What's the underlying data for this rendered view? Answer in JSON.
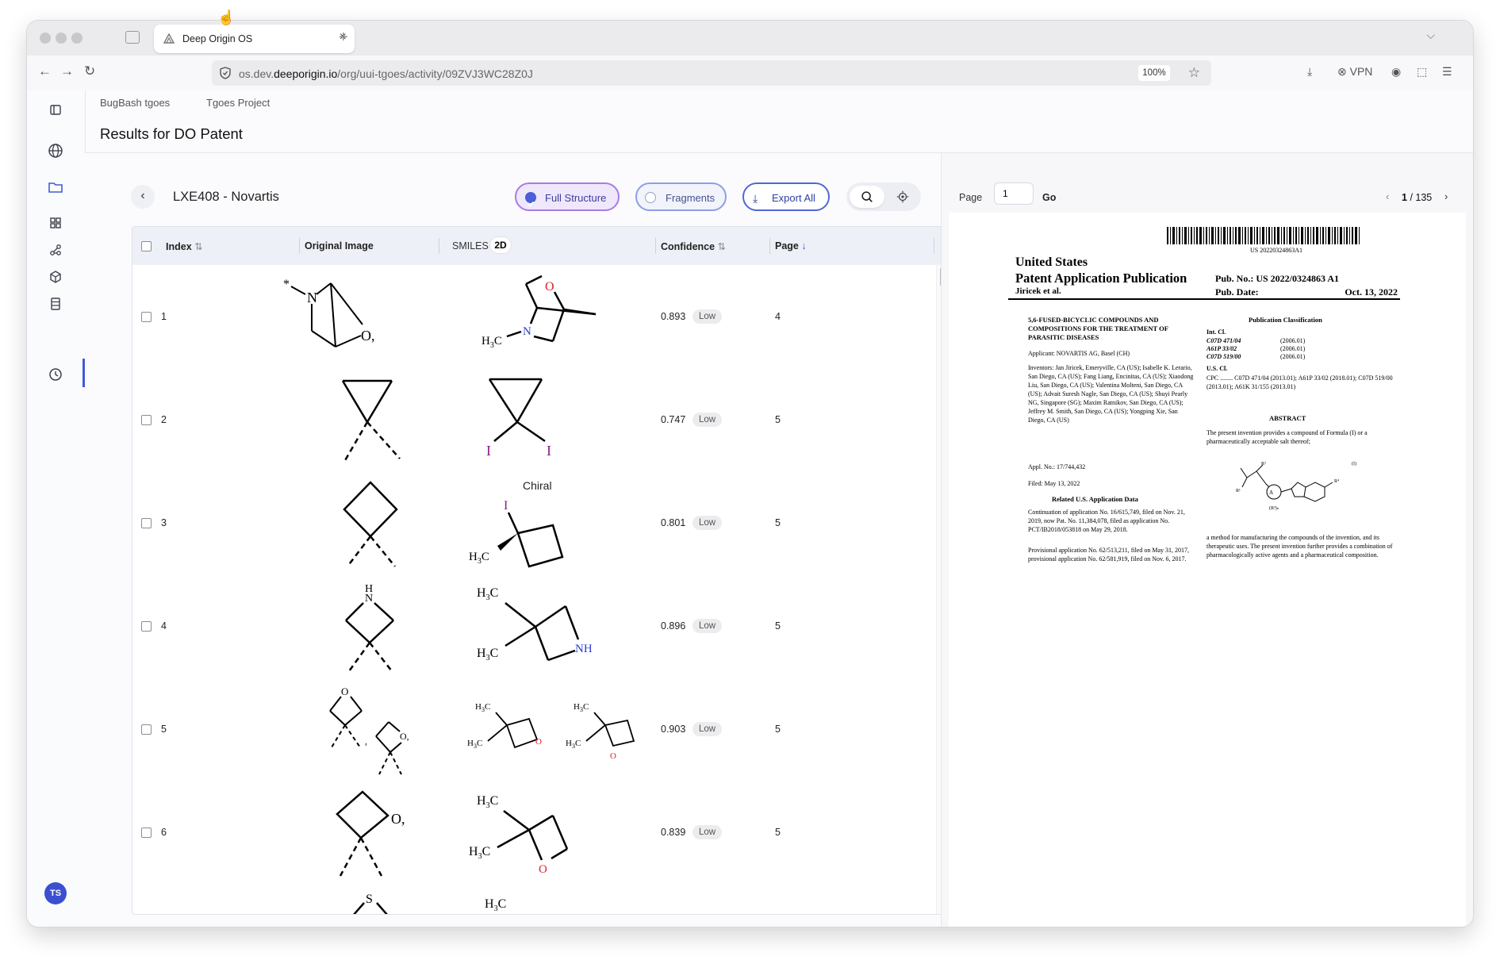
{
  "browser": {
    "tab_title": "Deep Origin OS",
    "url_prefix": "os.dev.",
    "url_domain": "deeporigin.io",
    "url_path": "/org/uui-tgoes/activity/09ZVJ3WC28Z0J",
    "zoom": "100%",
    "vpn_label": "VPN"
  },
  "breadcrumb": [
    "BugBash tgoes",
    "Tgoes Project"
  ],
  "page_title": "Results for DO Patent",
  "document": {
    "title": "LXE408 - Novartis",
    "full_structure_label": "Full Structure",
    "fragments_label": "Fragments",
    "export_label": "Export All"
  },
  "table": {
    "headers": {
      "index": "Index",
      "original_image": "Original Image",
      "smiles": "SMILES",
      "smiles_mode": "2D",
      "confidence": "Confidence",
      "page": "Page"
    },
    "rows": [
      {
        "index": "1",
        "confidence": "0.893",
        "level": "Low",
        "page": "4"
      },
      {
        "index": "2",
        "confidence": "0.747",
        "level": "Low",
        "page": "5"
      },
      {
        "index": "3",
        "confidence": "0.801",
        "level": "Low",
        "page": "5"
      },
      {
        "index": "4",
        "confidence": "0.896",
        "level": "Low",
        "page": "5"
      },
      {
        "index": "5",
        "confidence": "0.903",
        "level": "Low",
        "page": "5"
      },
      {
        "index": "6",
        "confidence": "0.839",
        "level": "Low",
        "page": "5"
      }
    ],
    "chiral_label": "Chiral"
  },
  "viewer": {
    "page_label": "Page",
    "page_input": "1",
    "go_label": "Go",
    "current_page": "1",
    "total_pages": "/ 135"
  },
  "patent": {
    "barcode_text": "US 20220324863A1",
    "country": "United States",
    "pub_type": "Patent Application Publication",
    "inventor_short": "Jiricek et al.",
    "pub_no_label": "Pub. No.:",
    "pub_no": "US 2022/0324863 A1",
    "pub_date_label": "Pub. Date:",
    "pub_date": "Oct. 13, 2022",
    "title": "5,6-FUSED-BICYCLIC COMPOUNDS AND COMPOSITIONS FOR THE TREATMENT OF PARASITIC DISEASES",
    "applicant": "Applicant: NOVARTIS AG, Basel (CH)",
    "inventors": "Inventors: Jan Jiricek, Emeryville, CA (US); Isabelle K. Lerario, San Diego, CA (US); Fang Liang, Encinitas, CA (US); Xiaodong Liu, San Diego, CA (US); Valentina Molteni, San Diego, CA (US); Advait Suresh Nagle, San Diego, CA (US); Shuyi Pearly NG, Singapore (SG); Maxim Ratnikov, San Diego, CA (US); Jeffrey M. Smith, San Diego, CA (US); Yongping Xie, San Diego, CA (US)",
    "appl_no": "Appl. No.: 17/744,432",
    "filed": "Filed: May 13, 2022",
    "related_heading": "Related U.S. Application Data",
    "continuation": "Continuation of application No. 16/615,749, filed on Nov. 21, 2019, now Pat. No. 11,384,078, filed as application No. PCT/IB2018/053818 on May 29, 2018.",
    "provisional": "Provisional application No. 62/513,211, filed on May 31, 2017, provisional application No. 62/581,919, filed on Nov. 6, 2017.",
    "pub_class_heading": "Publication Classification",
    "int_cl": "Int. Cl.",
    "cl1": "C07D 471/04",
    "cl2": "A61P 33/02",
    "cl3": "C07D 519/00",
    "cl_year": "(2006.01)",
    "us_cl": "U.S. Cl.",
    "cpc": "CPC ........ C07D 471/04 (2013.01); A61P 33/02 (2018.01); C07D 519/00 (2013.01); A61K 31/155 (2013.01)",
    "abstract_heading": "ABSTRACT",
    "abstract": "The present invention provides a compound of Formula (I) or a pharmaceutically acceptable salt thereof;",
    "abstract2": "a method for manufacturing the compounds of the invention, and its therapeutic uses. The present invention further provides a combination of pharmacologically active agents and a pharmaceutical composition."
  },
  "user_initials": "TS",
  "colors": {
    "accent": "#3f5bd6",
    "full_structure_bg": "#efe7fb",
    "oxygen": "#e0202a",
    "nitrogen": "#2a3fd1",
    "iodine": "#8a1a8a"
  }
}
